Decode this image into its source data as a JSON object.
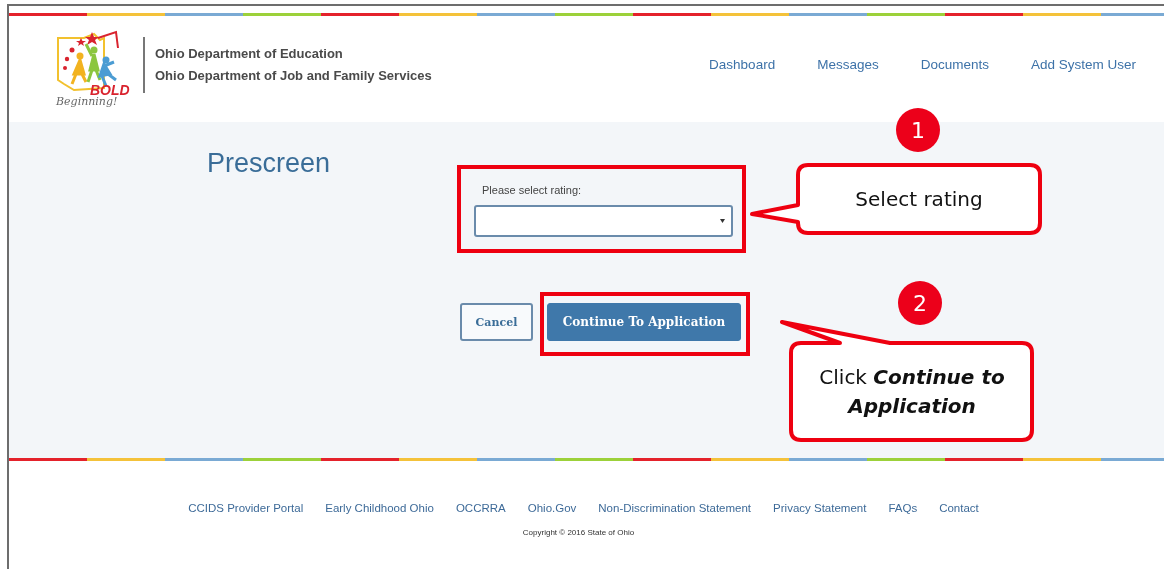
{
  "logo": {
    "title": "BOLD",
    "subtitle": "Beginning!"
  },
  "agencies": [
    "Ohio Department of Education",
    "Ohio Department of Job and Family Services"
  ],
  "nav": [
    {
      "label": "Dashboard"
    },
    {
      "label": "Messages"
    },
    {
      "label": "Documents"
    },
    {
      "label": "Add System User"
    }
  ],
  "page_title": "Prescreen",
  "rating_field": {
    "label": "Please select rating:"
  },
  "buttons": [
    {
      "label": "Cancel",
      "kind": "secondary"
    },
    {
      "label": "Continue To Application",
      "kind": "primary"
    }
  ],
  "annotations": [
    {
      "number": "1",
      "text": "Select rating"
    },
    {
      "number": "2",
      "text": "Click **Continue to Application**"
    }
  ],
  "footer_links": [
    "CCIDS Provider Portal",
    "Early Childhood Ohio",
    "OCCRRA",
    "Ohio.Gov",
    "Non-Discrimination Statement",
    "Privacy Statement",
    "FAQs",
    "Contact"
  ],
  "copyright": "Copyright © 2016 State of Ohio"
}
